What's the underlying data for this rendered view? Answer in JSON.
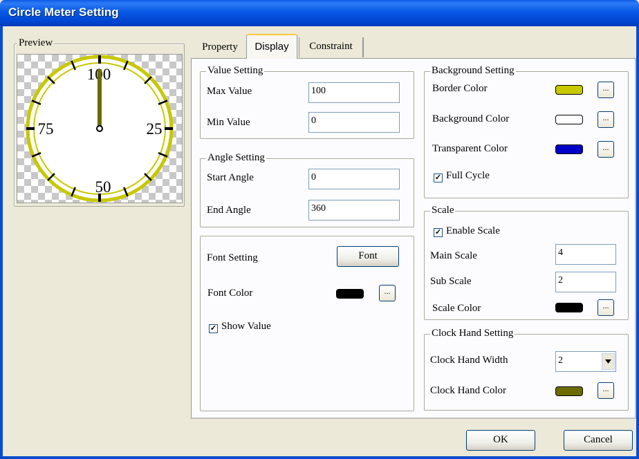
{
  "window": {
    "title": "Circle Meter Setting"
  },
  "preview": {
    "title": "Preview",
    "meter_labels": {
      "top": "100",
      "right": "25",
      "bottom": "50",
      "left": "75"
    },
    "value": 100,
    "border_color": "#c8c800",
    "hand_color": "#6b6b00"
  },
  "tabs": {
    "property": "Property",
    "display": "Display",
    "constraint": "Constraint"
  },
  "value_setting": {
    "title": "Value Setting",
    "max_label": "Max Value",
    "max_value": "100",
    "min_label": "Min Value",
    "min_value": "0"
  },
  "angle_setting": {
    "title": "Angle Setting",
    "start_label": "Start Angle",
    "start_value": "0",
    "end_label": "End Angle",
    "end_value": "360"
  },
  "font_setting": {
    "label": "Font Setting",
    "font_button": "Font",
    "color_label": "Font Color",
    "color": "#000000",
    "ellipsis": "...",
    "show_value_label": "Show Value",
    "show_value_checked": true
  },
  "background_setting": {
    "title": "Background Setting",
    "border_label": "Border Color",
    "border_color": "#c8c800",
    "background_label": "Background Color",
    "background_color": "#ffffff",
    "transparent_label": "Transparent Color",
    "transparent_color": "#0000c8",
    "full_cycle_label": "Full Cycle",
    "full_cycle_checked": true,
    "ellipsis": "..."
  },
  "scale": {
    "title": "Scale",
    "enable_label": "Enable Scale",
    "enable_checked": true,
    "main_label": "Main Scale",
    "main_value": "4",
    "sub_label": "Sub Scale",
    "sub_value": "2",
    "color_label": "Scale Color",
    "color": "#000000",
    "ellipsis": "..."
  },
  "clock_hand": {
    "title": "Clock Hand Setting",
    "width_label": "Clock Hand Width",
    "width_value": "2",
    "color_label": "Clock Hand Color",
    "color": "#6b6b00",
    "ellipsis": "..."
  },
  "footer": {
    "ok": "OK",
    "cancel": "Cancel"
  }
}
